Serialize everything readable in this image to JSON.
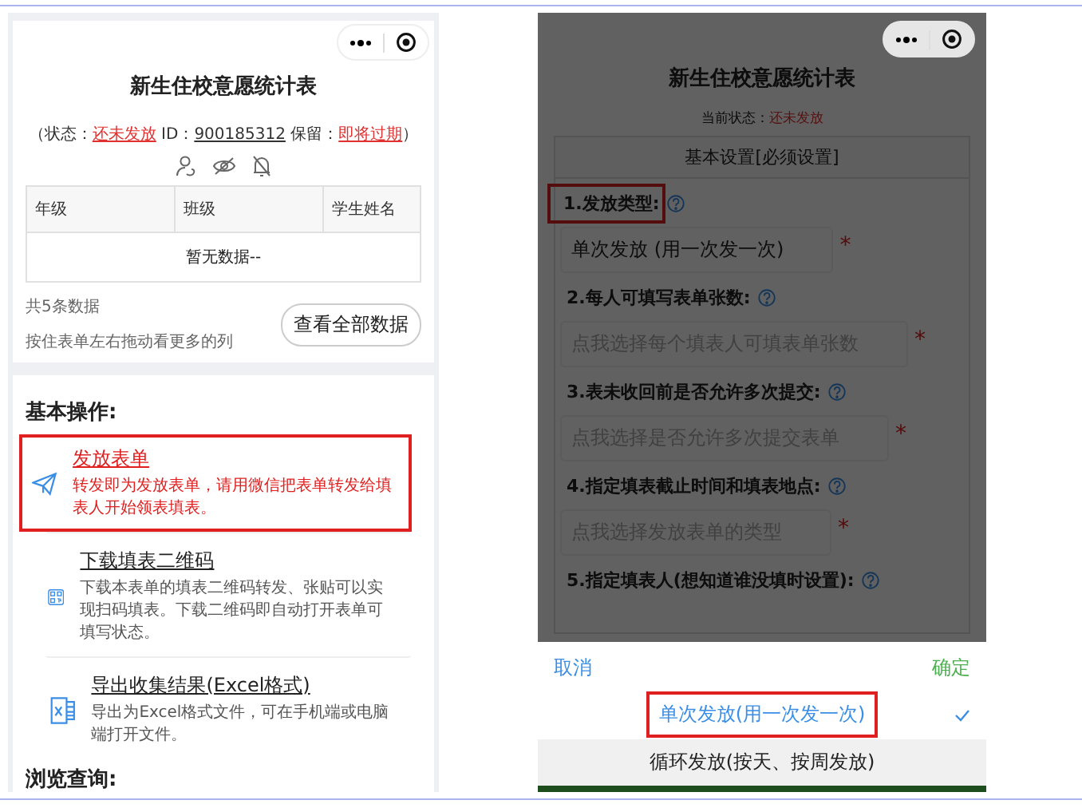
{
  "left": {
    "title": "新生住校意愿统计表",
    "status_parts": [
      {
        "kind": "text",
        "text": "（状态："
      },
      {
        "kind": "alert",
        "text": "还未发放"
      },
      {
        "kind": "text",
        "text": " ID："
      },
      {
        "kind": "link",
        "text": "900185312"
      },
      {
        "kind": "text",
        "text": " 保留："
      },
      {
        "kind": "alert",
        "text": "即将过期"
      },
      {
        "kind": "text",
        "text": "）"
      }
    ],
    "table": {
      "columns": [
        "年级",
        "班级",
        "学生姓名"
      ],
      "empty": "暂无数据--"
    },
    "count": "共5条数据",
    "hint": "按住表单左右拖动看更多的列",
    "view_all_button": "查看全部数据",
    "ops_title": "基本操作:",
    "ops": [
      {
        "kind": "send",
        "title": "发放表单",
        "desc": "转发即为发放表单，请用微信把表单转发给填表人开始领表填表。",
        "highlighted": true
      },
      {
        "kind": "qrcode",
        "title": "下载填表二维码",
        "desc": "下载本表单的填表二维码转发、张贴可以实现扫码填表。下载二维码即自动打开表单可填写状态。",
        "highlighted": false
      },
      {
        "kind": "excel",
        "title": "导出收集结果(Excel格式)",
        "desc": "导出为Excel格式文件，可在手机端或电脑端打开文件。",
        "highlighted": false
      }
    ],
    "browse_title": "浏览查询:"
  },
  "right": {
    "title": "新生住校意愿统计表",
    "status_label": "当前状态：",
    "status_value": "还未发放",
    "section_title": "基本设置[必须设置]",
    "fields": [
      {
        "label": "1.发放类型:",
        "value": "单次发放 (用一次发一次)",
        "mark": "*",
        "highlighted": true
      },
      {
        "label": "2.每人可填写表单张数:",
        "placeholder": "点我选择每个填表人可填表单张数",
        "mark": "*",
        "highlighted": false
      },
      {
        "label": "3.表未收回前是否允许多次提交:",
        "placeholder": "点我选择是否允许多次提交表单",
        "mark": "*",
        "highlighted": false
      },
      {
        "label": "4.指定填表截止时间和填表地点:",
        "placeholder": "点我选择发放表单的类型",
        "mark": "*",
        "highlighted": false
      },
      {
        "label": "5.指定填表人(想知道谁没填时设置):",
        "highlighted": false
      }
    ],
    "sheet": {
      "cancel": "取消",
      "confirm": "确定",
      "options": [
        {
          "label": "单次发放(用一次发一次)",
          "selected": true,
          "highlighted": true
        },
        {
          "label": "循环发放(按天、按周发放)",
          "selected": false,
          "highlighted": false
        }
      ]
    }
  }
}
